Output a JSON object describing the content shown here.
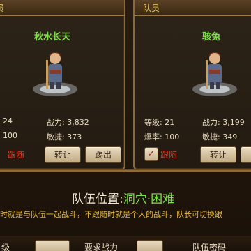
{
  "left_panel": {
    "header": "员",
    "name": "秋水长天",
    "level_value": "24",
    "power_value": "3,832",
    "crit_value": "100",
    "agility_label": "敏捷:",
    "agility_value": "373",
    "power_label": "战力:",
    "follow_label": "跟随",
    "transfer_label": "转让",
    "kick_label": "踢出"
  },
  "right_panel": {
    "header": "队员",
    "name": "骇兔",
    "level_label": "等级:",
    "level_value": "21",
    "power_label": "战力:",
    "power_value": "3,199",
    "crit_label": "爆率:",
    "crit_value": "100",
    "agility_label": "敏捷:",
    "agility_value": "349",
    "follow_label": "跟随",
    "transfer_label": "转让"
  },
  "team_position": {
    "label": "队伍位置:",
    "value": "洞穴·困难"
  },
  "info_text": "时就是与队伍一起战斗，不跟随时就是个人的战斗，队长可切换跟",
  "bottom": {
    "left_label": "级",
    "mid_label": "要求战力",
    "right_label": "队伍密码"
  },
  "colors": {
    "name_green": "#7ee04a",
    "follow_red": "#e03a28",
    "info_gold": "#e8b73a"
  }
}
